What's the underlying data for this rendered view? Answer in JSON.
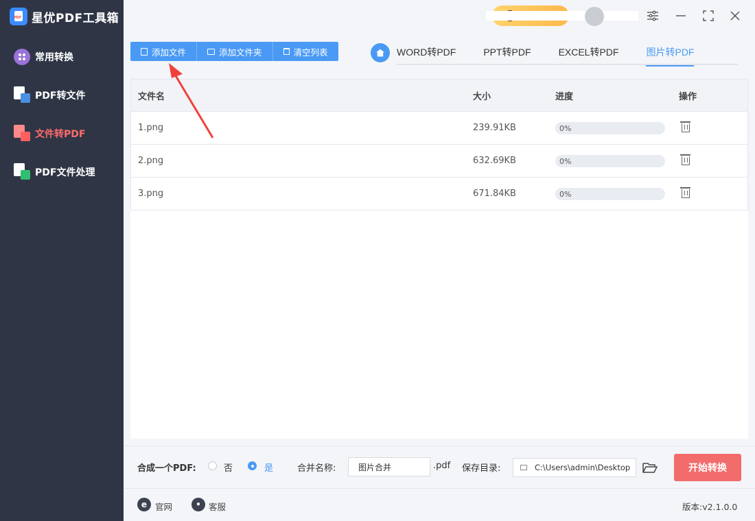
{
  "app": {
    "title": "星优PDF工具箱"
  },
  "sidebar": {
    "items": [
      {
        "label": "常用转换",
        "icon": "grid-icon",
        "active": false
      },
      {
        "label": "PDF转文件",
        "icon": "pdf-to-file-icon",
        "active": false
      },
      {
        "label": "文件转PDF",
        "icon": "file-to-pdf-icon",
        "active": true
      },
      {
        "label": "PDF文件处理",
        "icon": "pdf-process-icon",
        "active": false
      }
    ]
  },
  "toolbar": {
    "add_file": "添加文件",
    "add_folder": "添加文件夹",
    "clear_list": "清空列表"
  },
  "tabs": [
    {
      "label": "WORD转PDF",
      "active": false
    },
    {
      "label": "PPT转PDF",
      "active": false
    },
    {
      "label": "EXCEL转PDF",
      "active": false
    },
    {
      "label": "图片转PDF",
      "active": true
    }
  ],
  "table": {
    "headers": {
      "name": "文件名",
      "size": "大小",
      "progress": "进度",
      "action": "操作"
    },
    "rows": [
      {
        "name": "1.png",
        "size": "239.91KB",
        "progress": 0,
        "progress_label": "0%"
      },
      {
        "name": "2.png",
        "size": "632.69KB",
        "progress": 0,
        "progress_label": "0%"
      },
      {
        "name": "3.png",
        "size": "671.84KB",
        "progress": 0,
        "progress_label": "0%"
      }
    ]
  },
  "bottom": {
    "merge_label": "合成一个PDF:",
    "option_no": "否",
    "option_yes": "是",
    "merge_selected": "是",
    "merge_name_label": "合并名称:",
    "merge_name_value": "图片合并",
    "ext": ".pdf",
    "save_dir_label": "保存目录:",
    "save_dir_value": "C:\\Users\\admin\\Desktop",
    "start_button": "开始转换"
  },
  "footer": {
    "website": "官网",
    "support": "客服",
    "version": "版本:v2.1.0.0"
  },
  "colors": {
    "accent": "#4a9af5",
    "danger": "#f26c6c",
    "sidebar": "#2f3545",
    "active_nav": "#ff6b6b"
  }
}
